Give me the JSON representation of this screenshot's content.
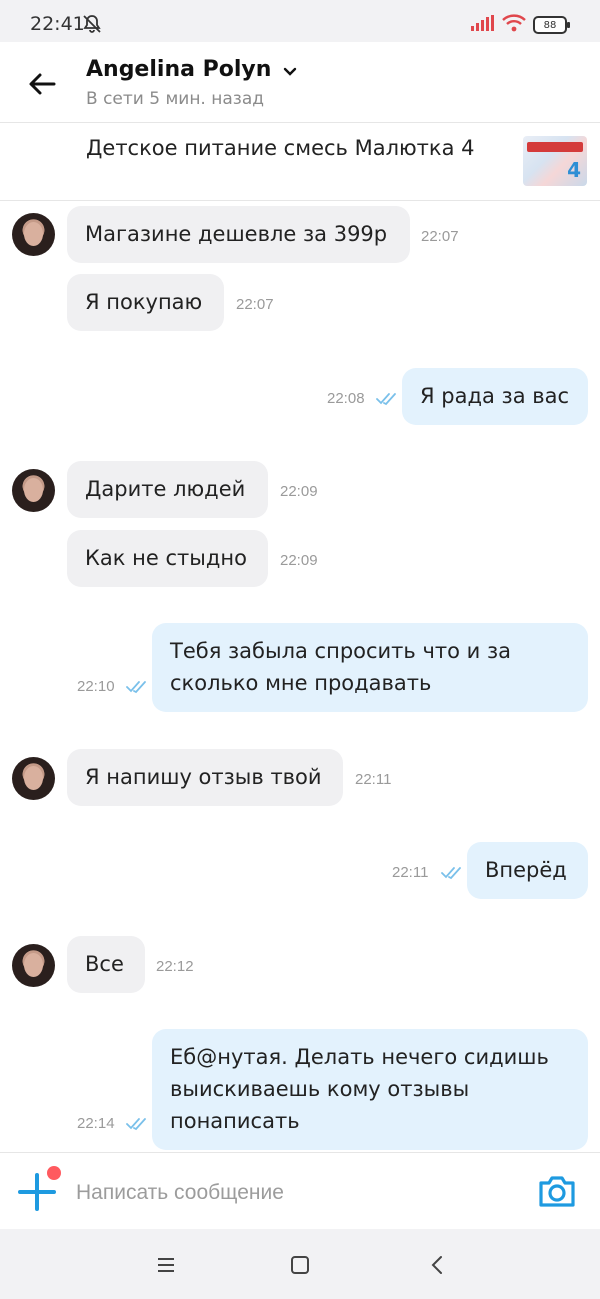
{
  "status_bar": {
    "time": "22:41",
    "battery": "88"
  },
  "header": {
    "name": "Angelina Polyn",
    "presence": "В сети 5 мин. назад"
  },
  "product": {
    "title": "Детское питание смесь Малютка 4"
  },
  "messages": [
    {
      "dir": "in",
      "text": "Магазине дешевле за 399р",
      "time": "22:07"
    },
    {
      "dir": "in",
      "text": "Я покупаю",
      "time": "22:07"
    },
    {
      "dir": "out",
      "text": "Я рада за вас",
      "time": "22:08"
    },
    {
      "dir": "in",
      "text": "Дарите людей",
      "time": "22:09"
    },
    {
      "dir": "in",
      "text": "Как не стыдно",
      "time": "22:09"
    },
    {
      "dir": "out",
      "text": "Тебя забыла спросить что и за сколько мне продавать",
      "time": "22:10"
    },
    {
      "dir": "in",
      "text": "Я напишу отзыв твой",
      "time": "22:11"
    },
    {
      "dir": "out",
      "text": "Вперёд",
      "time": "22:11"
    },
    {
      "dir": "in",
      "text": "Все",
      "time": "22:12"
    },
    {
      "dir": "out",
      "text": "Еб@нутая. Делать нечего сидишь выискиваешь кому отзывы понаписать",
      "time": "22:14"
    }
  ],
  "composer": {
    "placeholder": "Написать сообщение"
  },
  "colors": {
    "accent": "#1e9ae0",
    "outgoing_bubble": "#e3f2fd",
    "incoming_bubble": "#f0f0f2",
    "notification_dot": "#ff5a5f"
  },
  "icons": {
    "back": "arrow-left-icon",
    "dropdown": "chevron-down-icon",
    "attach": "plus-icon",
    "camera": "camera-icon",
    "read": "double-check-icon"
  }
}
